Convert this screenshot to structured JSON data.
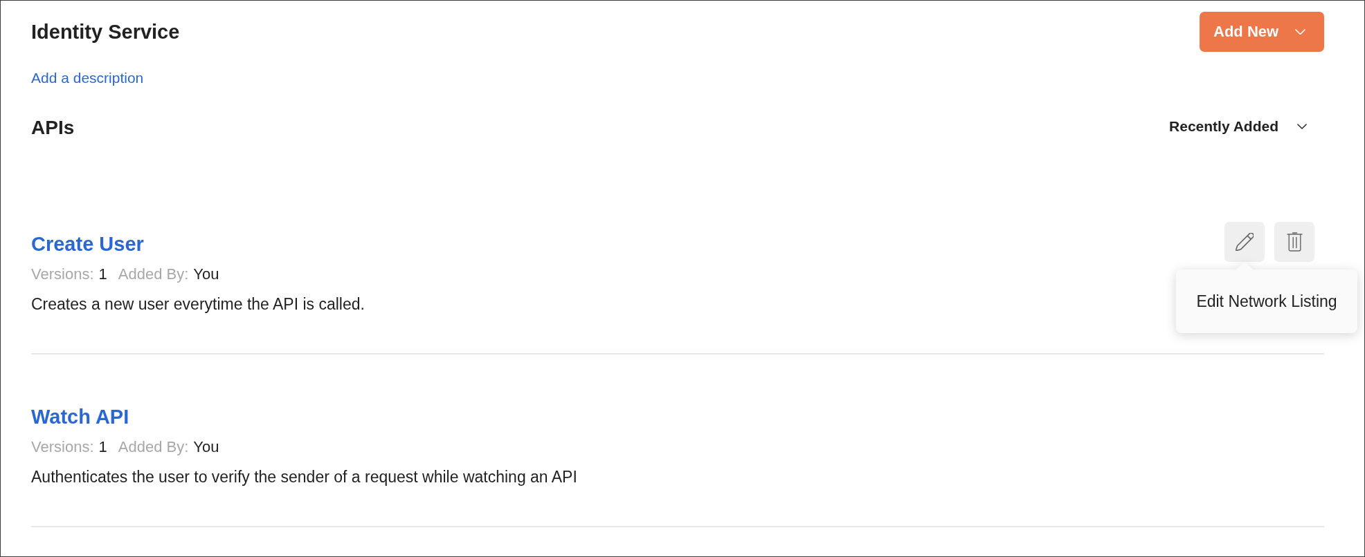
{
  "header": {
    "title": "Identity Service",
    "description_link": "Add a description",
    "add_button": "Add New"
  },
  "section": {
    "title": "APIs",
    "sort": "Recently Added"
  },
  "apis": [
    {
      "name": "Create User",
      "versions_label": "Versions:",
      "versions": "1",
      "added_by_label": "Added By:",
      "added_by": "You",
      "description": "Creates a new user everytime the API is called.",
      "hovered": true,
      "tooltip": "Edit Network Listing"
    },
    {
      "name": "Watch API",
      "versions_label": "Versions:",
      "versions": "1",
      "added_by_label": "Added By:",
      "added_by": "You",
      "description": "Authenticates the user to verify the sender of a request while watching an API",
      "hovered": false
    }
  ]
}
